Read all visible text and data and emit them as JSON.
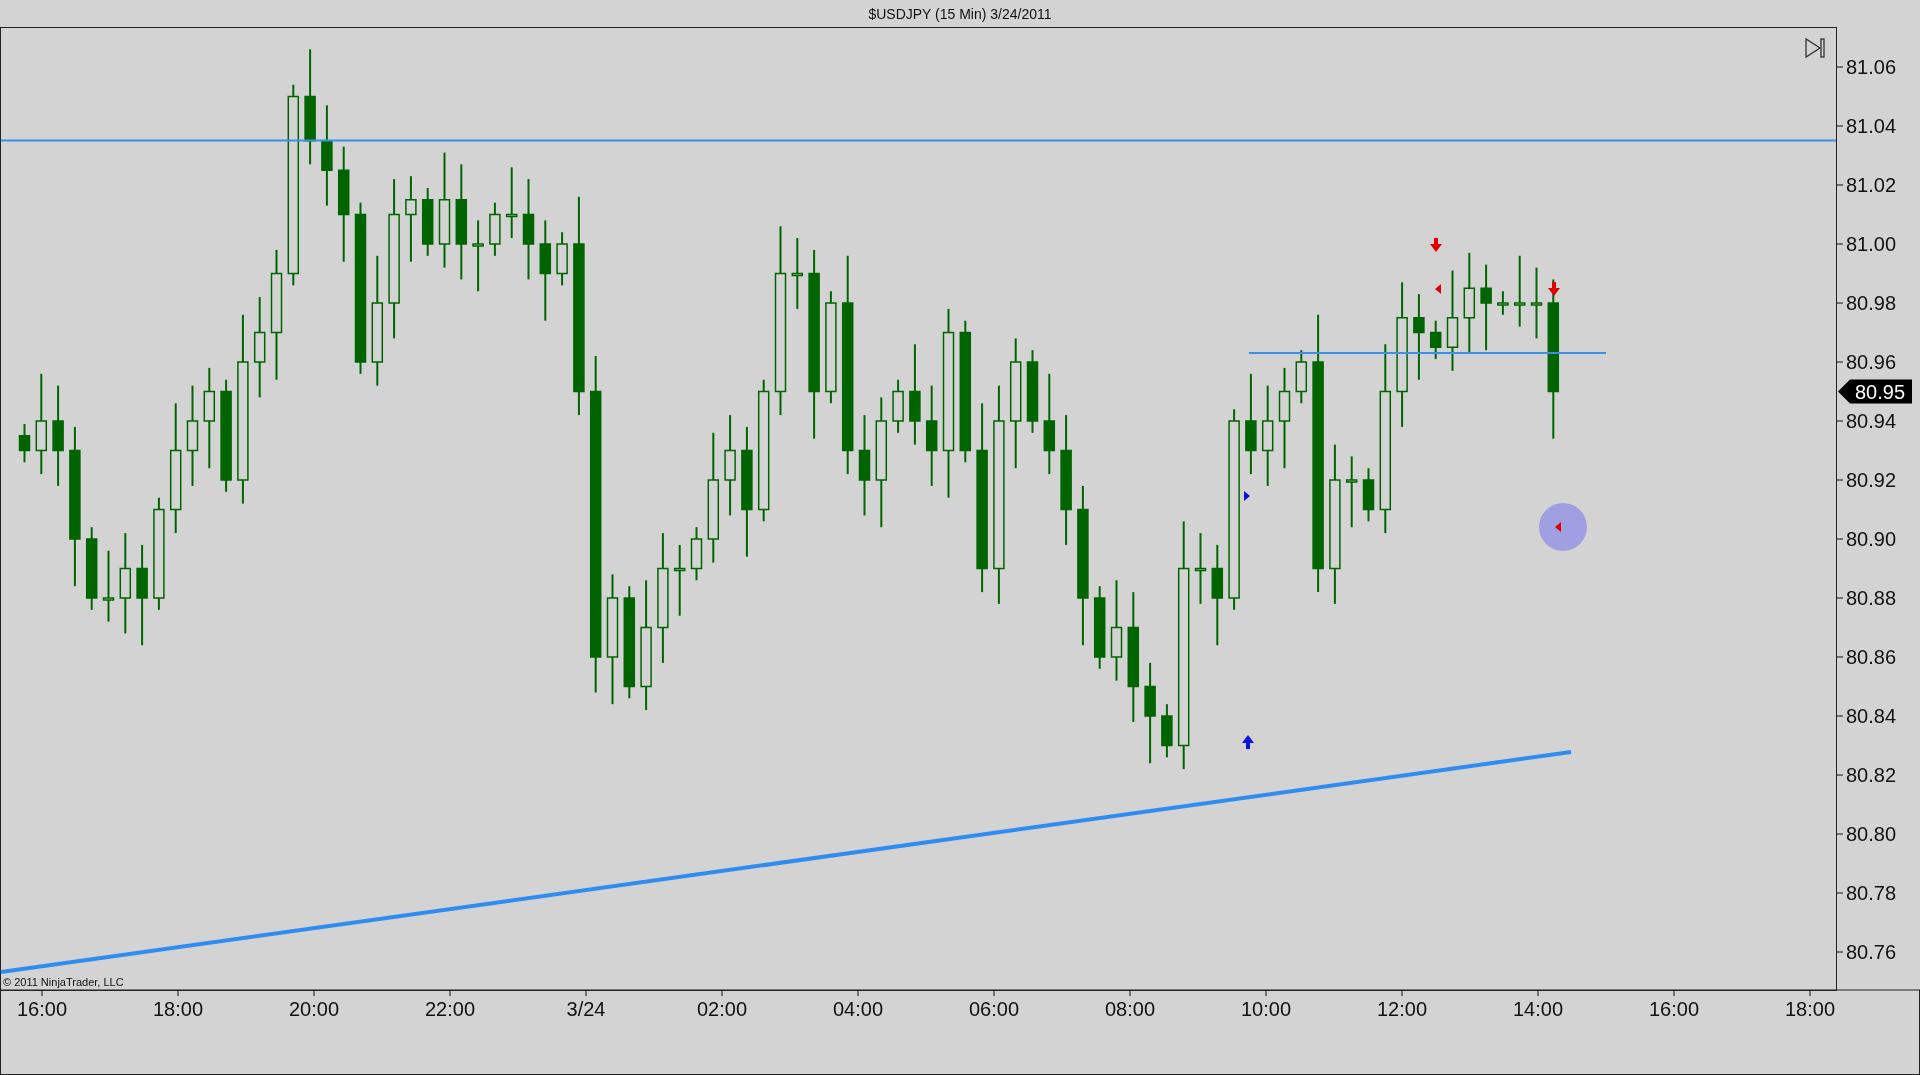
{
  "window": {
    "title": "$USDJPY (15 Min)  3/24/2011"
  },
  "chart": {
    "copyright": "© 2011 NinjaTrader, LLC",
    "last_price": "80.95",
    "price_axis": [
      "81.06",
      "81.04",
      "81.02",
      "81.00",
      "80.98",
      "80.96",
      "80.94",
      "80.92",
      "80.90",
      "80.88",
      "80.86",
      "80.84",
      "80.82",
      "80.80",
      "80.78",
      "80.76"
    ],
    "time_axis": [
      "16:00",
      "18:00",
      "20:00",
      "22:00",
      "3/24",
      "02:00",
      "04:00",
      "06:00",
      "08:00",
      "10:00",
      "12:00",
      "14:00",
      "16:00",
      "18:00"
    ]
  }
}
